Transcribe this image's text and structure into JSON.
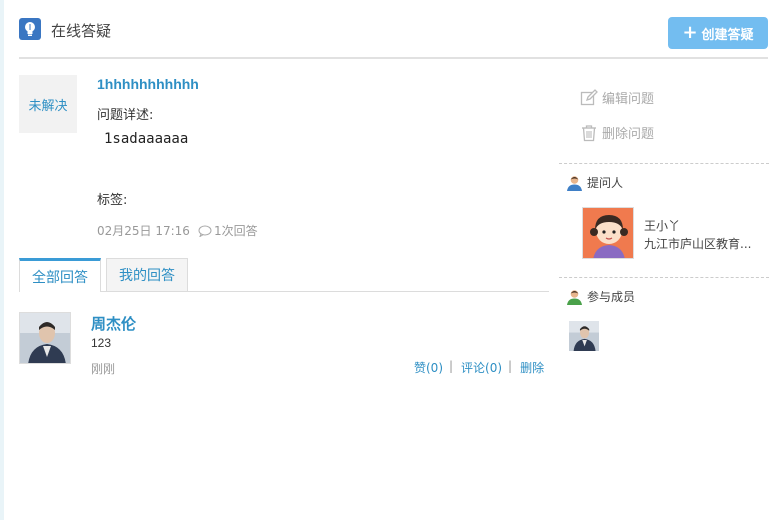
{
  "header": {
    "title": "在线答疑",
    "icon": "lightbulb-icon",
    "create_button": "创建答疑",
    "accent_color": "#3a76c2",
    "button_color": "#73bdf0"
  },
  "question": {
    "status": "未解决",
    "title": "1hhhhhhhhhhh",
    "desc_label": "问题详述:",
    "desc": "1sadaaaaaa",
    "tags_label": "标签:",
    "date": "02月25日 17:16",
    "answer_count": "1次回答"
  },
  "tabs": [
    {
      "label": "全部回答",
      "active": true
    },
    {
      "label": "我的回答",
      "active": false
    }
  ],
  "answers": [
    {
      "name": "周杰伦",
      "body": "123",
      "time": "刚刚",
      "like": "赞(0)",
      "comment": "评论(0)",
      "delete": "删除"
    }
  ],
  "sidebar": {
    "edit": "编辑问题",
    "delete": "删除问题",
    "asker_title": "提问人",
    "asker_name": "王小丫",
    "asker_org": "九江市庐山区教育...",
    "members_title": "参与成员"
  },
  "colors": {
    "link": "#2e8fc4",
    "muted": "#999999"
  }
}
